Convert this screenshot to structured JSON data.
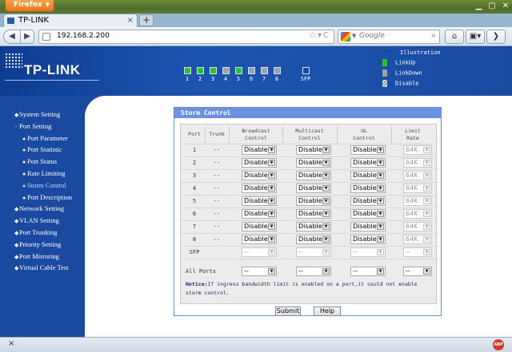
{
  "browser": {
    "app_button": "Firefox",
    "tab_title": "TP-LINK",
    "new_tab": "+",
    "url": "192.168.2.200",
    "search_placeholder": "Google",
    "back": "◀",
    "forward": "▶"
  },
  "banner": {
    "logo": "TP-LINK",
    "ports": [
      {
        "label": "1",
        "state": "up"
      },
      {
        "label": "2",
        "state": "up"
      },
      {
        "label": "3",
        "state": "up"
      },
      {
        "label": "4",
        "state": "off"
      },
      {
        "label": "5",
        "state": "up"
      },
      {
        "label": "6",
        "state": "off"
      },
      {
        "label": "7",
        "state": "off"
      },
      {
        "label": "8",
        "state": "off"
      },
      {
        "label": "SFP",
        "state": "sfp"
      }
    ],
    "legend": {
      "title": "Illustration",
      "link_up": "LinkUp",
      "link_down": "LinkDown",
      "disable": "Disable"
    }
  },
  "sidebar": {
    "items": [
      {
        "label": "System Setting",
        "level": 0,
        "bullet": "◆"
      },
      {
        "label": "Port Setting",
        "level": 0,
        "bullet": "−"
      },
      {
        "label": "Port Parameter",
        "level": 1,
        "bullet": "●"
      },
      {
        "label": "Port Statistic",
        "level": 1,
        "bullet": "●"
      },
      {
        "label": "Port Status",
        "level": 1,
        "bullet": "●"
      },
      {
        "label": "Rate Limiting",
        "level": 1,
        "bullet": "●"
      },
      {
        "label": "Storm Control",
        "level": 1,
        "bullet": "●",
        "active": true
      },
      {
        "label": "Port Description",
        "level": 1,
        "bullet": "●"
      },
      {
        "label": "Network Setting",
        "level": 0,
        "bullet": "◆"
      },
      {
        "label": "VLAN Setting",
        "level": 0,
        "bullet": "◆"
      },
      {
        "label": "Port Trunking",
        "level": 0,
        "bullet": "◆"
      },
      {
        "label": "Priority Setting",
        "level": 0,
        "bullet": "◆"
      },
      {
        "label": "Port Mirroring",
        "level": 0,
        "bullet": "◆"
      },
      {
        "label": "Virtual Cable Test",
        "level": 0,
        "bullet": "◆"
      }
    ]
  },
  "storm": {
    "title": "Storm Control",
    "headers": {
      "port": "Port",
      "trunk": "Trunk",
      "broadcast": [
        "Broadcast",
        "Control"
      ],
      "multicast": [
        "Multicast",
        "Control"
      ],
      "ul": [
        "UL",
        "Control"
      ],
      "limit": [
        "Limit",
        "Rate"
      ]
    },
    "rows": [
      {
        "port": "1",
        "trunk": "--",
        "broadcast": "Disable",
        "multicast": "Disable",
        "ul": "Disable",
        "rate": "64K"
      },
      {
        "port": "2",
        "trunk": "--",
        "broadcast": "Disable",
        "multicast": "Disable",
        "ul": "Disable",
        "rate": "64K"
      },
      {
        "port": "3",
        "trunk": "--",
        "broadcast": "Disable",
        "multicast": "Disable",
        "ul": "Disable",
        "rate": "64K"
      },
      {
        "port": "4",
        "trunk": "--",
        "broadcast": "Disable",
        "multicast": "Disable",
        "ul": "Disable",
        "rate": "64K"
      },
      {
        "port": "5",
        "trunk": "--",
        "broadcast": "Disable",
        "multicast": "Disable",
        "ul": "Disable",
        "rate": "64K"
      },
      {
        "port": "6",
        "trunk": "--",
        "broadcast": "Disable",
        "multicast": "Disable",
        "ul": "Disable",
        "rate": "64K"
      },
      {
        "port": "7",
        "trunk": "--",
        "broadcast": "Disable",
        "multicast": "Disable",
        "ul": "Disable",
        "rate": "64K"
      },
      {
        "port": "8",
        "trunk": "--",
        "broadcast": "Disable",
        "multicast": "Disable",
        "ul": "Disable",
        "rate": "64K"
      },
      {
        "port": "SFP",
        "trunk": "",
        "broadcast": "--",
        "multicast": "--",
        "ul": "--",
        "rate": "--",
        "disabled": true
      }
    ],
    "all_ports": {
      "label": "All Ports",
      "broadcast": "--",
      "multicast": "--",
      "ul": "--",
      "rate": "--"
    },
    "notice_label": "Notice:",
    "notice_text": "If ingress bandwidth limit is enabled on a port,it could not enable storm control.",
    "submit": "Submit",
    "help": "Help"
  },
  "status": {
    "close": "×",
    "addon": "ABP"
  }
}
